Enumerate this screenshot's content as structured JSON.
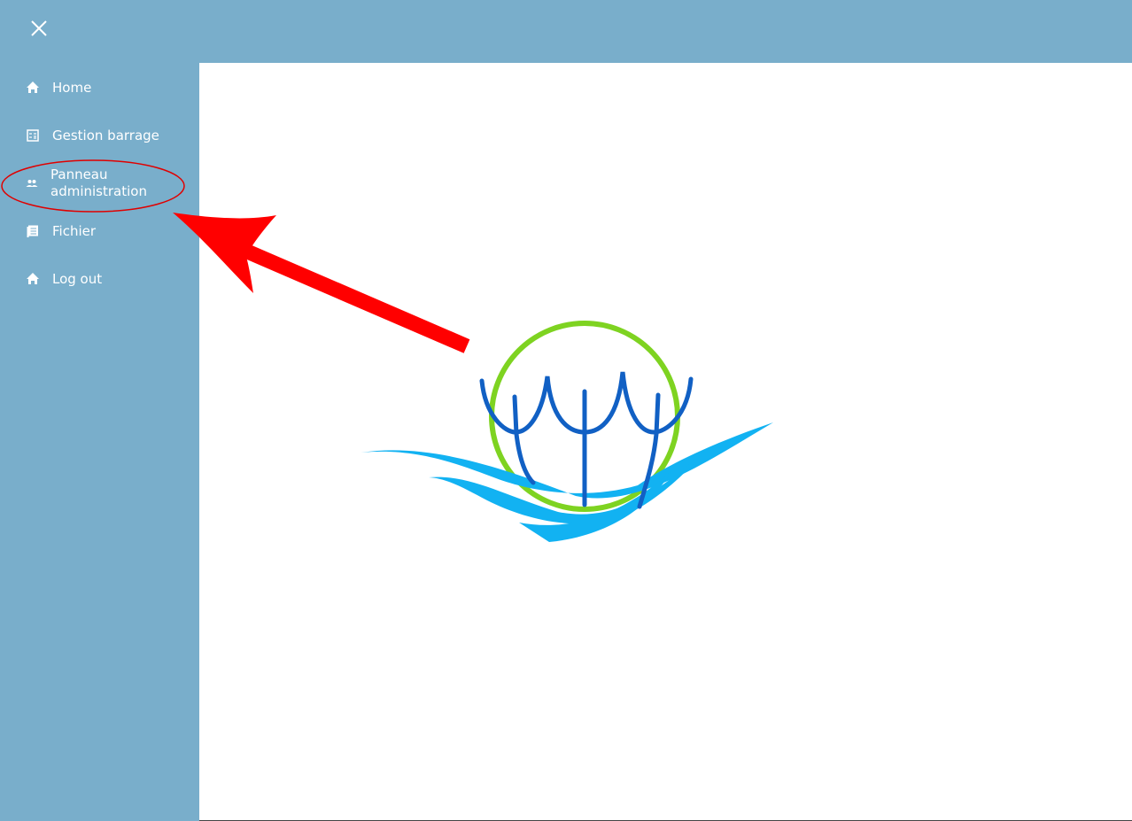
{
  "window": {
    "close_icon": "close-icon"
  },
  "sidebar": {
    "items": [
      {
        "label": "Home",
        "icon": "home-icon"
      },
      {
        "label": "Gestion barrage",
        "icon": "calculator-icon"
      },
      {
        "label": "Panneau administration",
        "icon": "people-icon"
      },
      {
        "label": "Fichier",
        "icon": "document-icon"
      },
      {
        "label": "Log out",
        "icon": "home-icon"
      }
    ]
  },
  "colors": {
    "sidebar_bg": "#79aecb",
    "content_bg": "#ffffff",
    "annotation_red": "#ff0000",
    "logo_green": "#7ed321",
    "logo_dark_blue": "#1160c4",
    "logo_light_blue": "#12b2f2"
  }
}
